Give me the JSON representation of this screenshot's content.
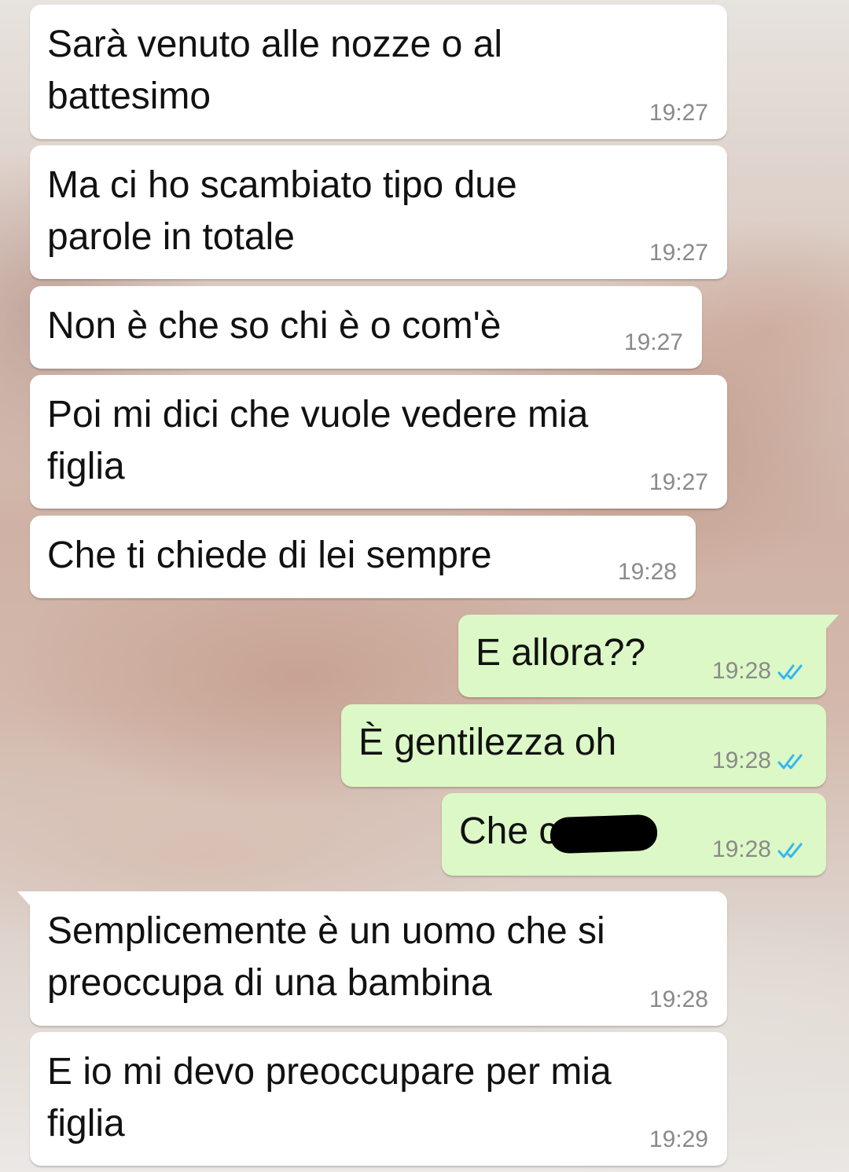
{
  "chat": {
    "incoming_color": "#ffffff",
    "outgoing_color": "#dcf8c6",
    "read_tick_color": "#34b7f1",
    "messages": [
      {
        "text": "Sarà venuto alle nozze o al\nbattesimo",
        "time": "19:27",
        "direction": "in"
      },
      {
        "text": "Ma ci ho scambiato tipo due\nparole in totale",
        "time": "19:27",
        "direction": "in"
      },
      {
        "text": "Non è che so chi è o com'è",
        "time": "19:27",
        "direction": "in"
      },
      {
        "text": "Poi mi dici che vuole vedere mia\nfiglia",
        "time": "19:27",
        "direction": "in"
      },
      {
        "text": "Che ti chiede di lei sempre",
        "time": "19:28",
        "direction": "in"
      },
      {
        "text": "E allora??",
        "time": "19:28",
        "direction": "out",
        "status_icon": "double-check-read-icon"
      },
      {
        "text": "È gentilezza oh",
        "time": "19:28",
        "direction": "out",
        "status_icon": "double-check-read-icon"
      },
      {
        "text": "Che c",
        "time": "19:28",
        "direction": "out",
        "status_icon": "double-check-read-icon",
        "redacted": true
      },
      {
        "text": "Semplicemente è un uomo che si\npreoccupa di una bambina",
        "time": "19:28",
        "direction": "in"
      },
      {
        "text": "E io mi devo preoccupare per mia\nfiglia",
        "time": "19:29",
        "direction": "in"
      }
    ]
  }
}
